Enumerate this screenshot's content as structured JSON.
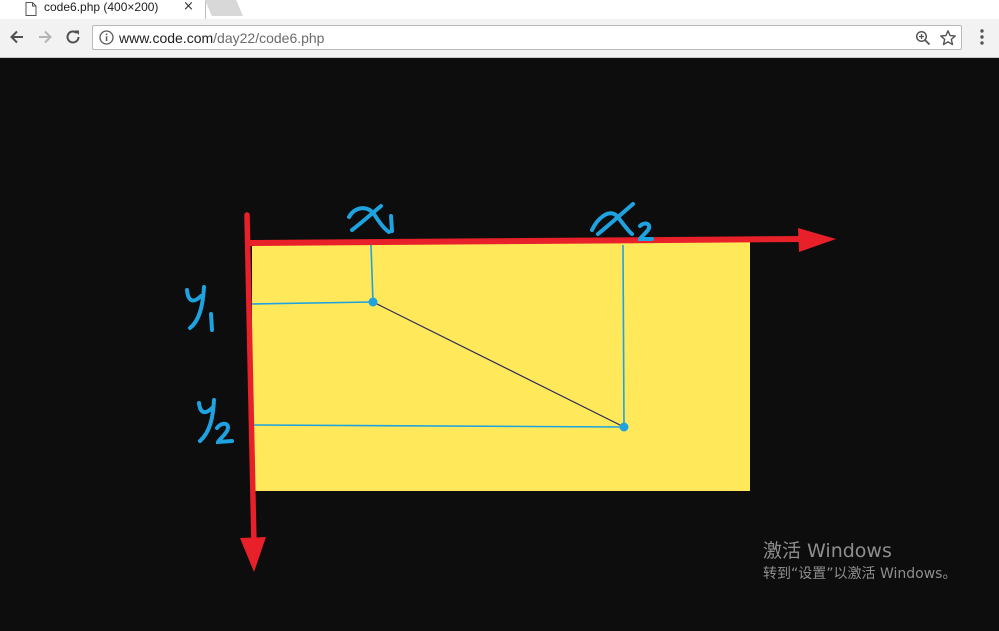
{
  "browser": {
    "tab": {
      "title": "code6.php (400×200)",
      "close_glyph": "×",
      "icon": "document-icon"
    },
    "url": {
      "host": "www.code.com",
      "path": "/day22/code6.php"
    },
    "icons": [
      "back-arrow-icon",
      "forward-arrow-icon",
      "reload-icon",
      "info-icon",
      "zoom-icon",
      "star-icon",
      "menu-icon"
    ]
  },
  "canvas": {
    "rect_color": "#ffe95a",
    "axis_color": "#e8202a",
    "annotation_color": "#1ea3e0",
    "labels": {
      "x1": "x₁",
      "x2": "x₂",
      "y1": "y₁",
      "y2": "y₂"
    }
  },
  "watermark": {
    "title": "激活 Windows",
    "subtitle": "转到“设置”以激活 Windows。"
  }
}
